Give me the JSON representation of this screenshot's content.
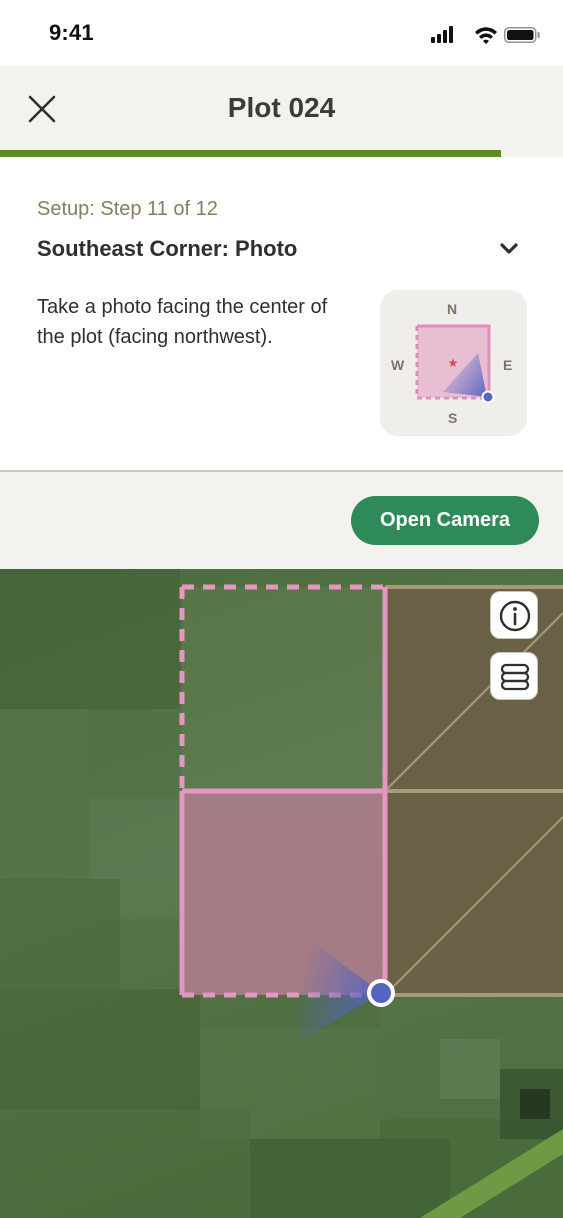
{
  "status_bar": {
    "time": "9:41"
  },
  "header": {
    "title": "Plot 024",
    "close_icon": "close-icon"
  },
  "progress": {
    "current_step": 11,
    "total_steps": 12,
    "fraction": 0.889
  },
  "step": {
    "label": "Setup: Step 11 of 12",
    "title": "Southeast Corner: Photo",
    "description": "Take a photo facing the center of the plot (facing northwest).",
    "expand_icon": "chevron-down-icon"
  },
  "compass": {
    "north": "N",
    "south": "S",
    "east": "E",
    "west": "W"
  },
  "actions": {
    "open_camera_label": "Open Camera"
  },
  "map": {
    "info_icon": "info-icon",
    "layers_icon": "layers-icon"
  },
  "colors": {
    "accent_green": "#2e8a58",
    "progress_green": "#5b8a2a",
    "plot_pink": "#e497c0",
    "location_blue": "#5563c1"
  }
}
